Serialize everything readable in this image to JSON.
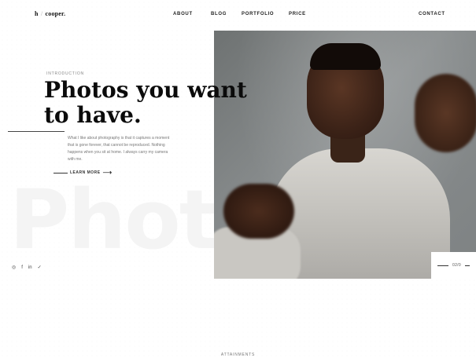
{
  "brand": {
    "logo_left": "h",
    "logo_sep": "/",
    "logo_right": "cooper."
  },
  "nav": {
    "about": "ABOUT",
    "blog": "BLOG",
    "portfolio": "PORTFOLIO",
    "price": "PRICE",
    "contact": "CONTACT"
  },
  "hero": {
    "label": "INTRODUCTION",
    "headline_line1": "Photos you want",
    "headline_line2": "to have.",
    "body": "What I like about photography is that it captures a moment that is gone forever, that cannot be reproduced. Nothing happens when you sit at home. I always carry my camera with me.",
    "cta": "LEARN MORE",
    "watermark": "Photo"
  },
  "social": {
    "icons": [
      "instagram-icon",
      "facebook-icon",
      "linkedin-icon",
      "twitter-icon"
    ],
    "labels": [
      "◎",
      "f",
      "in",
      "✓"
    ]
  },
  "slider": {
    "counter": "02/0"
  },
  "section": {
    "attainments": "ATTAINMENTS"
  },
  "colors": {
    "text": "#111111",
    "muted": "#777777",
    "background": "#ffffff"
  }
}
